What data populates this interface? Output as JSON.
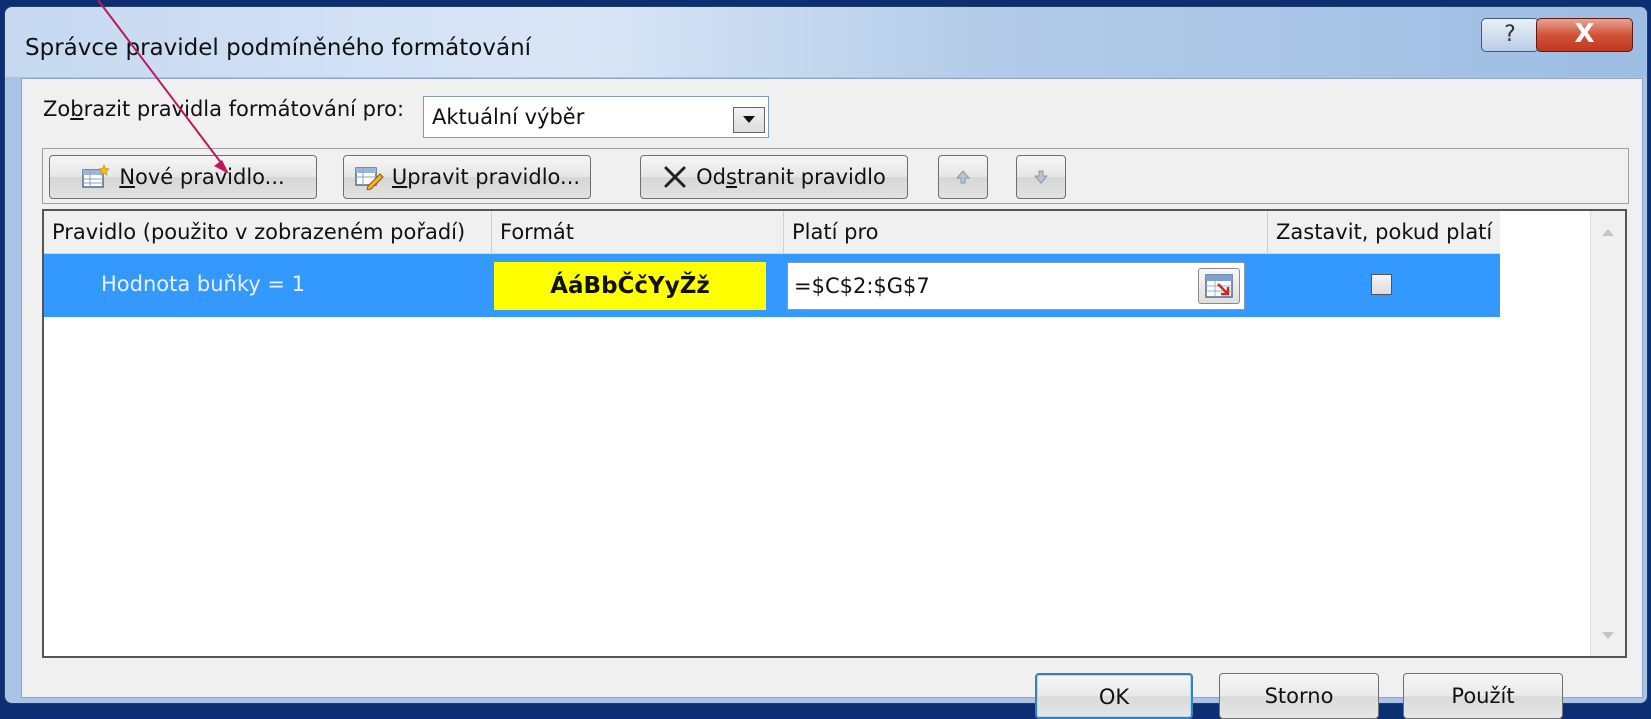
{
  "dialog": {
    "title": "Správce pravidel podmíněného formátování",
    "help_glyph": "?",
    "close_glyph": "X"
  },
  "show_rules": {
    "label_pre": "Zo",
    "label_mnemonic": "b",
    "label_post": "razit pravidla formátování pro:",
    "selected": "Aktuální výběr"
  },
  "toolbar": {
    "new_mnemonic": "N",
    "new_rest": "ové pravidlo...",
    "edit_mnemonic": "U",
    "edit_rest": "pravit pravidlo...",
    "delete_pre": "Od",
    "delete_mnemonic": "s",
    "delete_post": "tranit pravidlo"
  },
  "grid": {
    "columns": [
      "Pravidlo (použito v zobrazeném pořadí)",
      "Formát",
      "Platí pro",
      "Zastavit, pokud platí"
    ],
    "rows": [
      {
        "rule": "Hodnota buňky = 1",
        "format_preview": "ÁáBbČčYyŽž",
        "applies_to": "=$C$2:$G$7",
        "stop_if_true": false
      }
    ]
  },
  "buttons": {
    "ok": "OK",
    "cancel": "Storno",
    "apply": "Použít"
  },
  "colors": {
    "selection": "#3399ff",
    "format_preview_bg": "#ffff00",
    "annotation_arrow": "#c0185c"
  }
}
